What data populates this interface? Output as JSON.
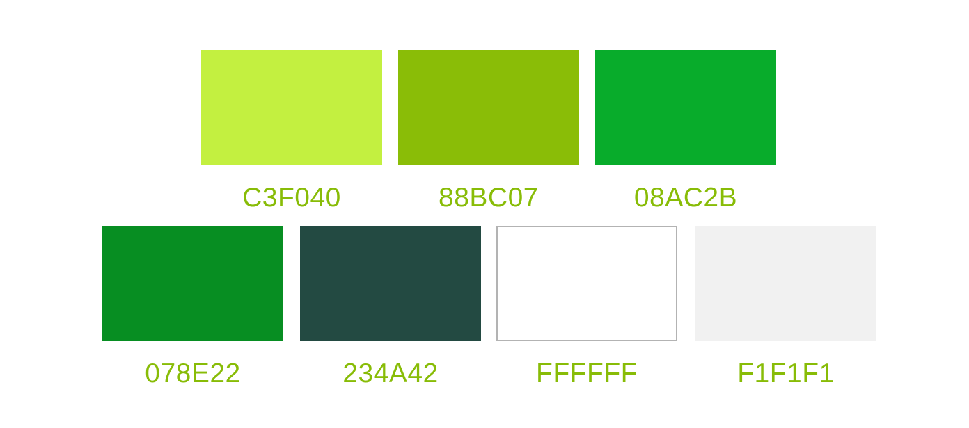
{
  "label_color": "#88BC07",
  "swatches": [
    {
      "label": "C3F040",
      "color": "#C3F040"
    },
    {
      "label": "88BC07",
      "color": "#8ABD07"
    },
    {
      "label": "08AC2B",
      "color": "#08AC2B"
    },
    {
      "label": "078E22",
      "color": "#078E22"
    },
    {
      "label": "234A42",
      "color": "#234A42"
    },
    {
      "label": "FFFFFF",
      "color": "#FFFFFF",
      "outlined": true
    },
    {
      "label": "F1F1F1",
      "color": "#F1F1F1"
    }
  ]
}
